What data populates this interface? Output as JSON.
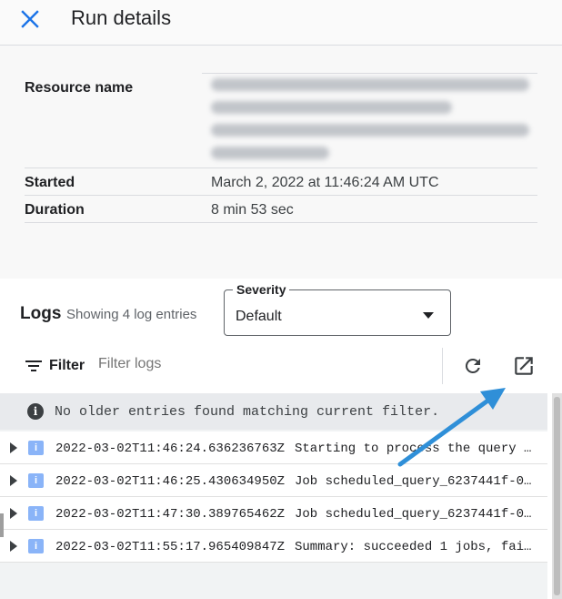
{
  "header": {
    "title": "Run details"
  },
  "details": {
    "resource_name_label": "Resource name",
    "started_label": "Started",
    "started_value": "March 2, 2022 at 11:46:24 AM UTC",
    "duration_label": "Duration",
    "duration_value": "8 min 53 sec"
  },
  "logs": {
    "title": "Logs",
    "count_text": "Showing 4 log entries",
    "severity": {
      "label": "Severity",
      "selected": "Default"
    },
    "filter_label": "Filter",
    "filter_placeholder": "Filter logs",
    "no_older_text": "No older entries found matching current filter.",
    "entries": [
      {
        "severity": "i",
        "timestamp": "2022-03-02T11:46:24.636236763Z",
        "message": "Starting to process the query j…"
      },
      {
        "severity": "i",
        "timestamp": "2022-03-02T11:46:25.430634950Z",
        "message": "Job scheduled_query_6237441f-00…"
      },
      {
        "severity": "i",
        "timestamp": "2022-03-02T11:47:30.389765462Z",
        "message": "Job scheduled_query_6237441f-00…"
      },
      {
        "severity": "i",
        "timestamp": "2022-03-02T11:55:17.965409847Z",
        "message": "Summary: succeeded 1 jobs, fail…"
      }
    ]
  },
  "icons": {
    "close": "close-icon",
    "refresh": "refresh-icon",
    "open_in_new": "open-in-new-icon",
    "filter": "filter-icon",
    "info": "info-icon"
  },
  "colors": {
    "accent_blue": "#1a73e8",
    "annotation_arrow": "#2f8fd8",
    "info_badge": "#8ab4f8"
  }
}
